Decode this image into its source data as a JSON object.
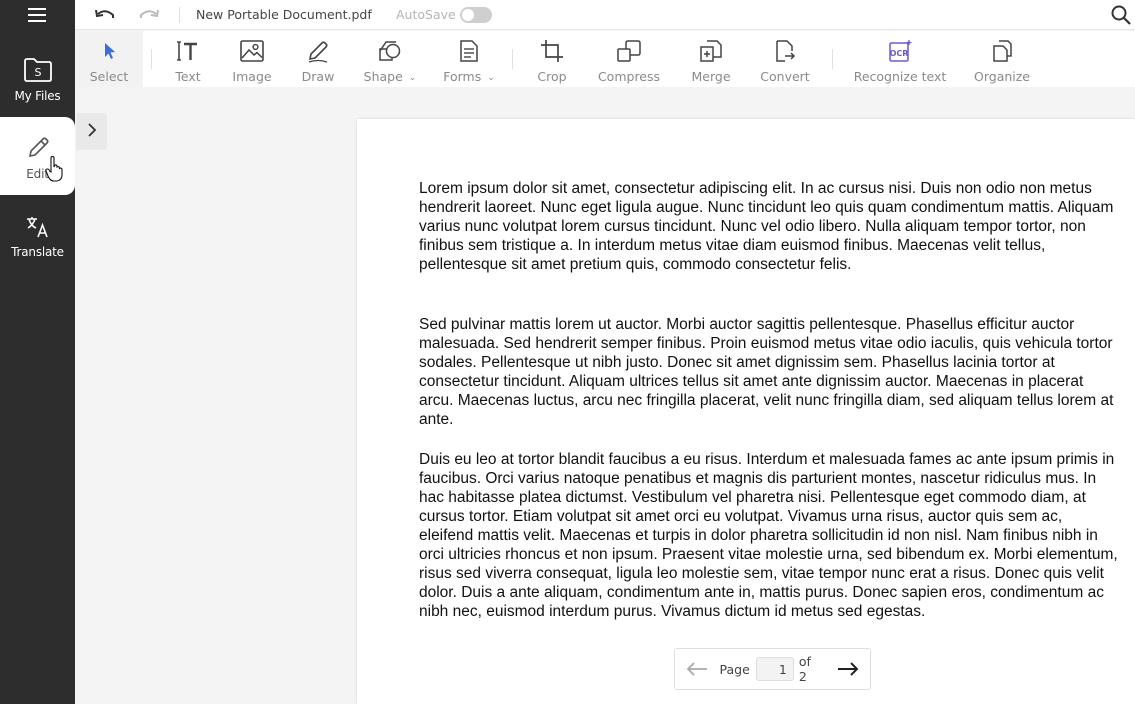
{
  "sidebar": {
    "menu_icon": "hamburger-menu-icon",
    "items": [
      {
        "label": "My Files",
        "icon": "folder-icon"
      },
      {
        "label": "Edit",
        "icon": "pencil-icon"
      },
      {
        "label": "Translate",
        "icon": "translate-icon"
      }
    ]
  },
  "topbar": {
    "document_title": "New Portable Document.pdf",
    "autosave_label": "AutoSave",
    "autosave_on": false
  },
  "toolbar": {
    "tools": [
      {
        "label": "Select",
        "icon": "cursor-icon"
      },
      {
        "label": "Text",
        "icon": "text-icon"
      },
      {
        "label": "Image",
        "icon": "image-icon"
      },
      {
        "label": "Draw",
        "icon": "pen-icon"
      },
      {
        "label": "Shape",
        "icon": "shape-icon"
      },
      {
        "label": "Forms",
        "icon": "forms-icon"
      },
      {
        "label": "Crop",
        "icon": "crop-icon"
      },
      {
        "label": "Compress",
        "icon": "compress-icon"
      },
      {
        "label": "Merge",
        "icon": "merge-icon"
      },
      {
        "label": "Convert",
        "icon": "convert-icon"
      },
      {
        "label": "Recognize text",
        "icon": "ocr-icon"
      },
      {
        "label": "Organize",
        "icon": "organize-icon"
      }
    ]
  },
  "document": {
    "paragraphs": [
      "Lorem ipsum dolor sit amet, consectetur adipiscing elit. In ac cursus nisi. Duis non odio non metus hendrerit laoreet. Nunc eget ligula augue. Nunc tincidunt leo quis quam condimentum mattis. Aliquam varius nunc volutpat lorem cursus tincidunt. Nunc vel odio libero. Nulla aliquam tempor tortor, non finibus sem tristique a. In interdum metus vitae diam euismod finibus. Maecenas velit tellus, pellentesque sit amet pretium quis, commodo consectetur felis.",
      "Sed pulvinar mattis lorem ut auctor. Morbi auctor sagittis pellentesque. Phasellus efficitur auctor malesuada. Sed hendrerit semper finibus. Proin euismod metus vitae odio iaculis, quis vehicula tortor sodales. Pellentesque ut nibh justo. Donec sit amet dignissim sem. Phasellus lacinia tortor at consectetur tincidunt. Aliquam ultrices tellus sit amet ante dignissim auctor. Maecenas in placerat arcu. Maecenas luctus, arcu nec fringilla placerat, velit nunc fringilla diam, sed aliquam tellus lorem at ante.",
      "Duis eu leo at tortor blandit faucibus a eu risus. Interdum et malesuada fames ac ante ipsum primis in faucibus. Orci varius natoque penatibus et magnis dis parturient montes, nascetur ridiculus mus. In hac habitasse platea dictumst. Vestibulum vel pharetra nisi. Pellentesque eget commodo diam, at cursus tortor. Etiam volutpat sit amet orci eu volutpat. Vivamus urna risus, auctor quis sem ac, eleifend mattis velit. Maecenas et turpis in dolor pharetra sollicitudin id non nisl. Nam finibus nibh in orci ultricies rhoncus et non ipsum. Praesent vitae molestie urna, sed bibendum ex. Morbi elementum, risus sed viverra consequat, ligula leo molestie sem, vitae tempor nunc erat a risus. Donec quis velit dolor. Duis a ante aliquam, condimentum ante in, mattis purus. Donec sapien eros, condimentum ac nibh nec, euismod interdum purus. Vivamus dictum id metus sed egestas."
    ]
  },
  "pager": {
    "page_label": "Page",
    "current_page": "1",
    "total_label": "of 2"
  },
  "colors": {
    "sidebar_bg": "#2d2d2d",
    "accent": "#3b6fd8",
    "ocr_accent": "#6a5acd"
  }
}
